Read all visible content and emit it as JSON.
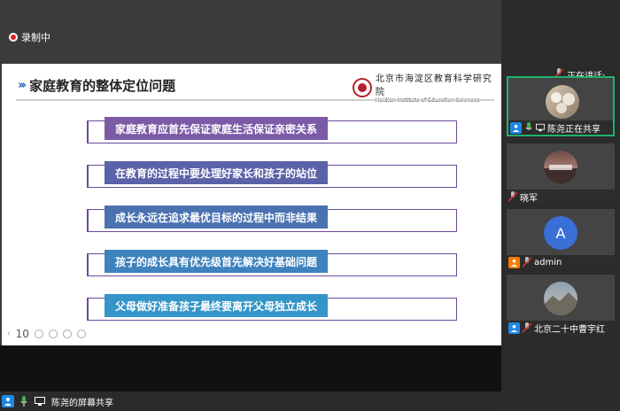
{
  "recording": {
    "label": "录制中"
  },
  "slide": {
    "title": "家庭教育的整体定位问题",
    "logo": {
      "name_cn": "北京市海淀区教育科学研究院",
      "name_en": "Haidian Institute of Education Sciences"
    },
    "items": [
      {
        "text": "家庭教育应首先保证家庭生活保证亲密关系",
        "color": "#7b5aa6"
      },
      {
        "text": "在教育的过程中要处理好家长和孩子的站位",
        "color": "#5a62a8"
      },
      {
        "text": "成长永远在追求最优目标的过程中而非结果",
        "color": "#4a72b0"
      },
      {
        "text": "孩子的成长具有优先级首先解决好基础问题",
        "color": "#3e83bd"
      },
      {
        "text": "父母做好准备孩子最终要离开父母独立成长",
        "color": "#3595c8"
      }
    ],
    "page_number": "10"
  },
  "speaking": {
    "label": "正在讲话:"
  },
  "participants": [
    {
      "name": "陈尧正在共享",
      "avatar": "photo-avatar",
      "active": true
    },
    {
      "name": "晓军",
      "avatar": "landscape-avatar",
      "active": false
    },
    {
      "name": "admin",
      "avatar_letter": "A",
      "avatar_color": "#3a6fd8",
      "active": false
    },
    {
      "name": "北京二十中曹宇红",
      "avatar": "landscape-avatar",
      "active": false
    }
  ],
  "share_bar": {
    "label": "陈尧的屏幕共享"
  },
  "colors": {
    "accent_blue": "#1e88e5",
    "active_green": "#1fb36b",
    "mute_red": "#e53935",
    "orange": "#f57c00"
  }
}
